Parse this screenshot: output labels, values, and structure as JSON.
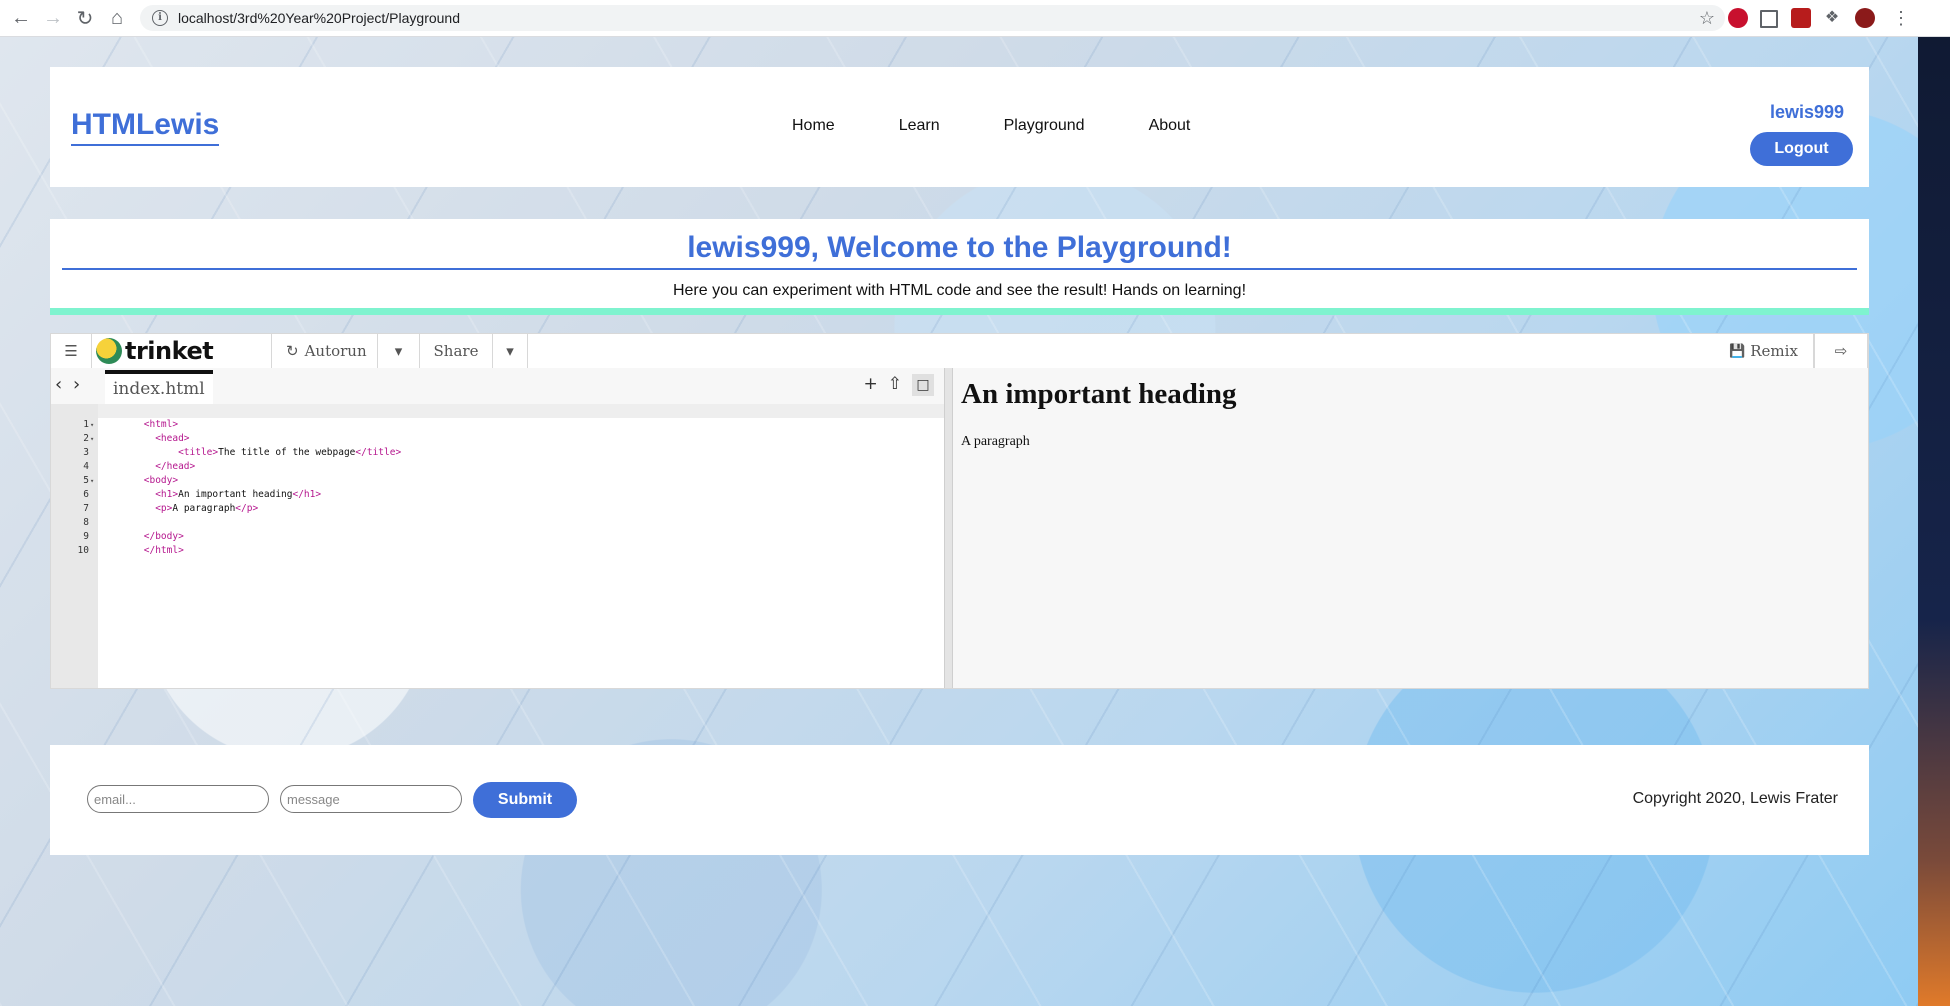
{
  "browser": {
    "url": "localhost/3rd%20Year%20Project/Playground",
    "icons": [
      "back-icon",
      "forward-icon",
      "reload-icon",
      "home-icon",
      "info-icon",
      "bookmark-star-icon",
      "adblock-icon",
      "grid-extension-icon",
      "pdf-extension-icon",
      "puzzle-extensions-icon",
      "profile-avatar",
      "kebab-menu-icon"
    ]
  },
  "header": {
    "logo": "HTMLewis",
    "nav": [
      "Home",
      "Learn",
      "Playground",
      "About"
    ],
    "username": "lewis999",
    "logout_label": "Logout"
  },
  "welcome": {
    "title": "lewis999, Welcome to the Playground!",
    "subtitle": "Here you can experiment with HTML code and see the result! Hands on learning!"
  },
  "trinket": {
    "brand": "trinket",
    "autorun_label": "Autorun",
    "share_label": "Share",
    "remix_label": "Remix",
    "file_tab": "index.html",
    "line_numbers": [
      "1",
      "2",
      "3",
      "4",
      "5",
      "6",
      "7",
      "8",
      "9",
      "10"
    ],
    "code": {
      "l1": "<html>",
      "l2": "  <head>",
      "l3a": "      <title>",
      "l3b": "The title of the webpage",
      "l3c": "</title>",
      "l4": "  </head>",
      "l5": "<body>",
      "l6a": "  <h1>",
      "l6b": "An important heading",
      "l6c": "</h1>",
      "l7a": "  <p>",
      "l7b": "A paragraph",
      "l7c": "</p>",
      "l9": "</body>",
      "l10": "</html>"
    },
    "preview": {
      "heading": "An important heading",
      "paragraph": "A paragraph"
    }
  },
  "footer": {
    "email_placeholder": "email...",
    "message_placeholder": "message",
    "submit_label": "Submit",
    "copyright": "Copyright 2020, Lewis Frater"
  },
  "colors": {
    "accent": "#3f6fd8",
    "mint_border": "#7ff3cf",
    "code_tag": "#b5178e"
  }
}
